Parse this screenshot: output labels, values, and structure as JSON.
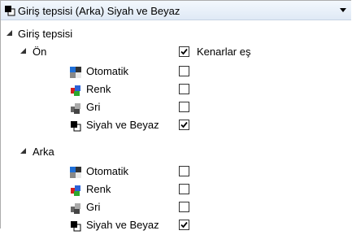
{
  "combo": {
    "value": "Giriş tepsisi (Arka) Siyah ve Beyaz",
    "icon": "black-white-mode-icon"
  },
  "tree": {
    "root": {
      "label": "Giriş tepsisi",
      "expanded": true
    },
    "front": {
      "label": "Ön",
      "expanded": true,
      "duplicate_label": "Kenarlar eş",
      "duplicate_checked": true,
      "modes": [
        {
          "label": "Otomatik",
          "icon": "auto-color-icon",
          "checked": false
        },
        {
          "label": "Renk",
          "icon": "color-icon",
          "checked": false
        },
        {
          "label": "Gri",
          "icon": "grayscale-icon",
          "checked": false
        },
        {
          "label": "Siyah ve Beyaz",
          "icon": "black-white-icon",
          "checked": true
        }
      ]
    },
    "back": {
      "label": "Arka",
      "expanded": true,
      "modes": [
        {
          "label": "Otomatik",
          "icon": "auto-color-icon",
          "checked": false
        },
        {
          "label": "Renk",
          "icon": "color-icon",
          "checked": false
        },
        {
          "label": "Gri",
          "icon": "grayscale-icon",
          "checked": false
        },
        {
          "label": "Siyah ve Beyaz",
          "icon": "black-white-icon",
          "checked": true
        }
      ]
    }
  }
}
